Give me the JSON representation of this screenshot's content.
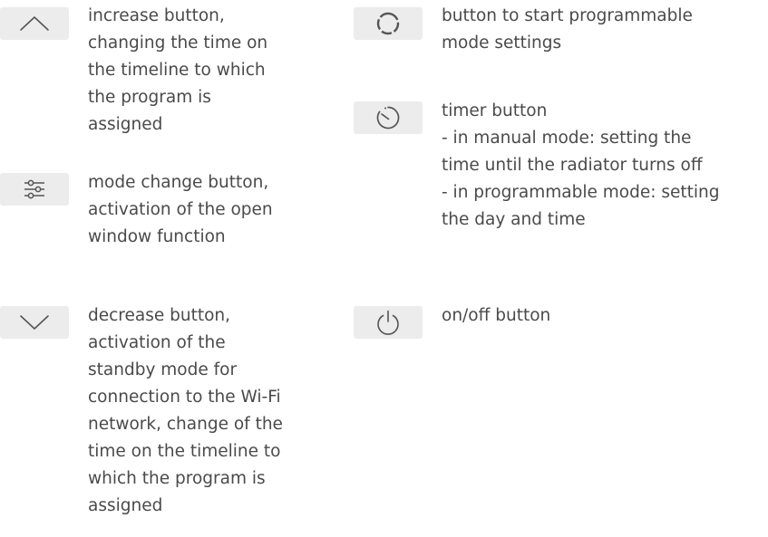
{
  "left_column": [
    {
      "icon": "chevron-up-icon",
      "description": "increase button,\nchanging the time on\nthe timeline to which\nthe program is\nassigned"
    },
    {
      "icon": "sliders-icon",
      "description": "mode change button,\nactivation of the open\nwindow function"
    },
    {
      "icon": "chevron-down-icon",
      "description": "decrease button,\nactivation of the\nstandby mode for\nconnection to the Wi-Fi\nnetwork, change of the\ntime on the timeline to\nwhich the program is\nassigned"
    }
  ],
  "right_column": [
    {
      "icon": "dashed-circle-icon",
      "description": "button to start programmable\nmode settings"
    },
    {
      "icon": "timer-icon",
      "description": "timer button\n- in manual mode: setting the\ntime until the radiator turns off\n- in programmable mode: setting\nthe day and time"
    },
    {
      "icon": "power-icon",
      "description": "on/off button"
    }
  ],
  "colors": {
    "icon_background": "#ececec",
    "icon_stroke": "#555555",
    "text": "#4a4a4a"
  }
}
